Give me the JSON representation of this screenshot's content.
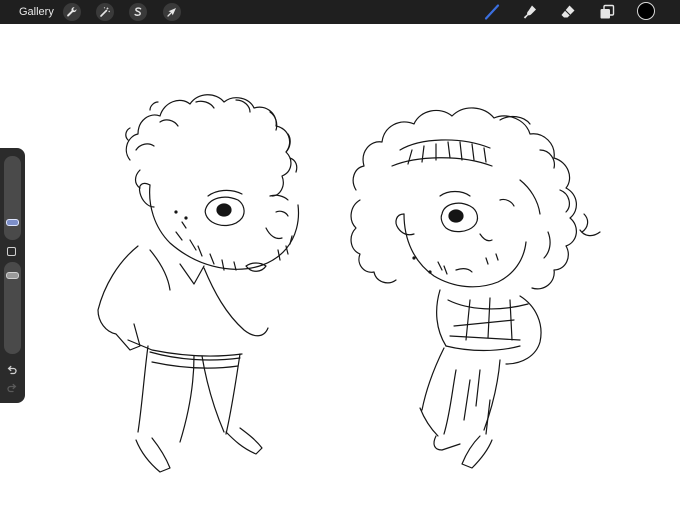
{
  "topbar": {
    "gallery_label": "Gallery",
    "left_tools": [
      {
        "name": "actions",
        "icon": "wrench-icon"
      },
      {
        "name": "adjustments",
        "icon": "magic-wand-icon"
      },
      {
        "name": "selection",
        "icon": "selection-s-icon"
      },
      {
        "name": "transform",
        "icon": "arrow-cursor-icon"
      }
    ],
    "right_tools": [
      {
        "name": "brush",
        "icon": "brush-icon",
        "active": true
      },
      {
        "name": "smudge",
        "icon": "smudge-icon"
      },
      {
        "name": "eraser",
        "icon": "eraser-icon"
      },
      {
        "name": "layers",
        "icon": "layers-icon"
      },
      {
        "name": "color",
        "icon": "color-swatch-icon",
        "value": "#000000"
      }
    ],
    "accent_color": "#3b6fe0"
  },
  "sidebar": {
    "brush_size_level": 0.72,
    "opacity_level": 0.1,
    "icons": [
      "modifier-square-icon",
      "undo-icon",
      "redo-icon"
    ]
  },
  "canvas": {
    "background": "#ffffff",
    "content": "sketch-illustration"
  }
}
